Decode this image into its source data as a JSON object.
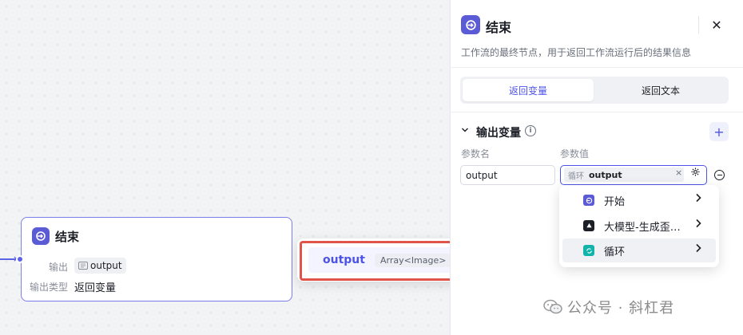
{
  "canvas_node": {
    "title": "结束",
    "output_label": "输出",
    "output_var": "output",
    "output_type_label": "输出类型",
    "output_type_value": "返回变量"
  },
  "suggestion": {
    "name": "output",
    "type": "Array<Image>"
  },
  "panel": {
    "title": "结束",
    "close_label": "✕",
    "description": "工作流的最终节点，用于返回工作流运行后的结果信息",
    "tabs": [
      {
        "label": "返回变量",
        "active": true
      },
      {
        "label": "返回文本",
        "active": false
      }
    ],
    "section_title": "输出变量",
    "add_label": "+",
    "col_name": "参数名",
    "col_value": "参数值",
    "param_name_value": "output",
    "param_value_source": "循环",
    "param_value_name": "output",
    "clear_label": "×"
  },
  "dropdown": {
    "items": [
      {
        "label": "开始",
        "icon": "start-node-icon",
        "color": "#5b5bd6"
      },
      {
        "label": "大模型-生成歪…",
        "icon": "llm-node-icon",
        "color": "#1d1f27"
      },
      {
        "label": "循环",
        "icon": "loop-node-icon",
        "color": "#12b3a8"
      }
    ]
  },
  "watermark": {
    "text": "公众号 · 斜杠君"
  },
  "colors": {
    "accent": "#4d53e8",
    "node_icon": "#5b5bd6",
    "highlight_red": "#e0544a"
  }
}
